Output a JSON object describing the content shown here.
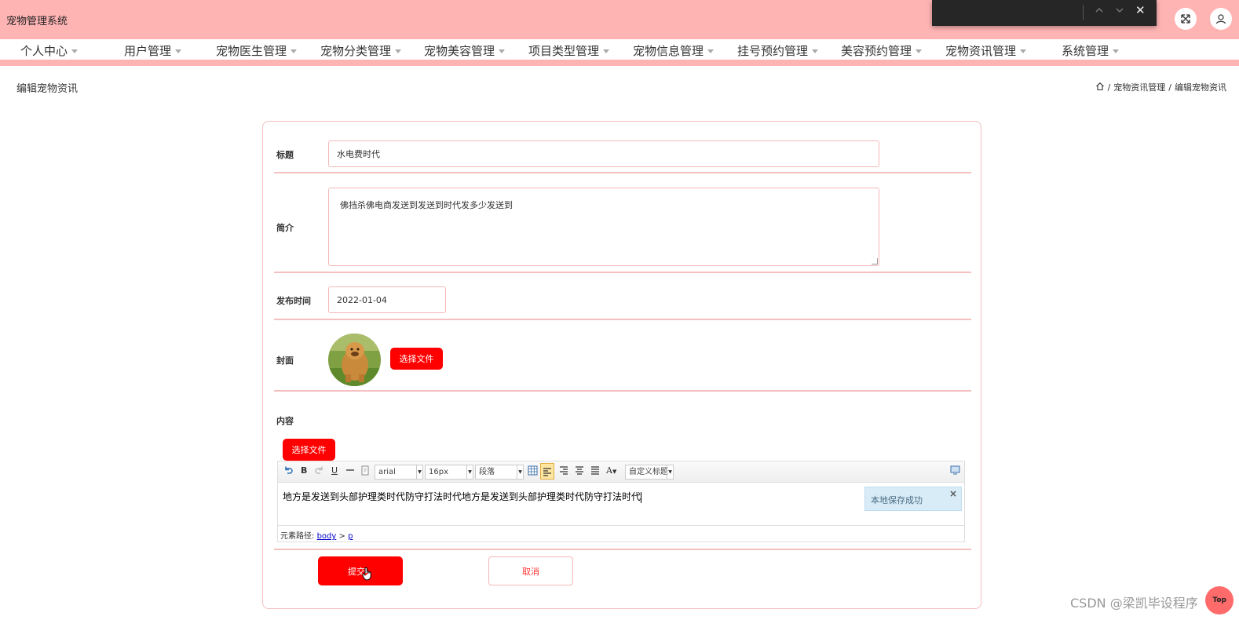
{
  "app": {
    "title": "宠物管理系统"
  },
  "colors": {
    "brand": "#ffb4b4",
    "accent": "#ff0000"
  },
  "window_controls": {
    "icons": [
      "chevron-up-icon",
      "chevron-down-icon",
      "close-icon"
    ],
    "close_glyph": "✕"
  },
  "header_icons": [
    "fullscreen-icon",
    "user-icon"
  ],
  "nav": {
    "items": [
      {
        "label": "个人中心"
      },
      {
        "label": "用户管理"
      },
      {
        "label": "宠物医生管理"
      },
      {
        "label": "宠物分类管理"
      },
      {
        "label": "宠物美容管理"
      },
      {
        "label": "项目类型管理"
      },
      {
        "label": "宠物信息管理"
      },
      {
        "label": "挂号预约管理"
      },
      {
        "label": "美容预约管理"
      },
      {
        "label": "宠物资讯管理"
      },
      {
        "label": "系统管理"
      }
    ]
  },
  "page": {
    "title": "编辑宠物资讯",
    "breadcrumb": {
      "home_icon": "home-icon",
      "sep": "/",
      "items": [
        "宠物资讯管理",
        "编辑宠物资讯"
      ]
    }
  },
  "form": {
    "title_label": "标题",
    "title_value": "水电费时代",
    "summary_label": "简介",
    "summary_value": "佛挡杀佛电商发送到发送到时代发多少发送到",
    "date_label": "发布时间",
    "date_value": "2022-01-04",
    "cover_label": "封面",
    "choose_file": "选择文件",
    "content_label": "内容",
    "content_choose_file": "选择文件",
    "submit": "提交",
    "cancel": "取消"
  },
  "editor": {
    "font_family": "arial",
    "font_size": "16px",
    "paragraph": "段落",
    "custom_title": "自定义标题",
    "toolbar_icons": [
      "undo-icon",
      "bold-icon",
      "redo-icon",
      "underline-icon",
      "horizontal-rule-icon",
      "paste-icon",
      "table-icon",
      "align-left-icon",
      "align-right-icon",
      "align-center-icon",
      "justify-icon",
      "font-color-icon",
      "fullscreen-icon"
    ],
    "bold_glyph": "B",
    "underline_glyph": "U",
    "font_color_glyph": "A",
    "content": "地方是发送到头部护理类时代防守打法时代地方是发送到头部护理类时代防守打法时代",
    "notice": "本地保存成功",
    "notice_close": "×",
    "path_label": "元素路径:",
    "path_body": "body",
    "path_sep": ">",
    "path_p": "p"
  },
  "watermark": "CSDN @梁凯毕设程序",
  "top_button": "Top"
}
